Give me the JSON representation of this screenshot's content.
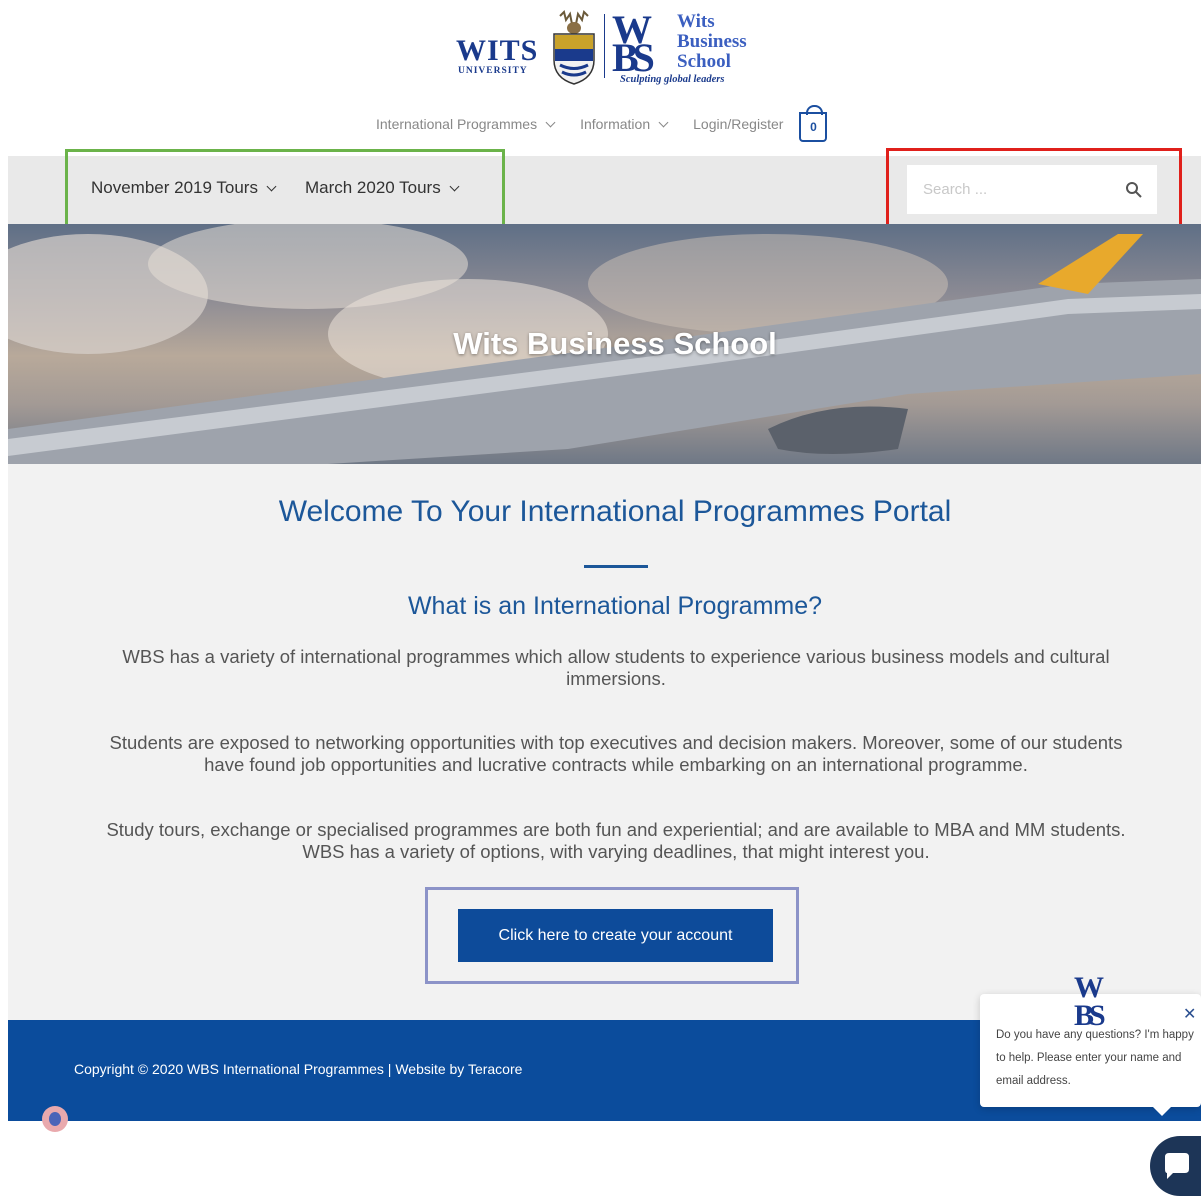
{
  "header": {
    "wits_logo_text": "WITS",
    "wits_logo_sub": "UNIVERSITY",
    "wbs_logo_mark_top": "W",
    "wbs_logo_mark_bottom": "BS",
    "wbs_logo_name": "Wits\nBusiness\nSchool",
    "wbs_logo_tagline": "Sculpting global leaders"
  },
  "top_nav": {
    "items": [
      {
        "label": "International Programmes"
      },
      {
        "label": "Information"
      },
      {
        "label": "Login/Register"
      }
    ],
    "cart_count": "0"
  },
  "secondary_nav": {
    "items": [
      {
        "label": "November 2019 Tours"
      },
      {
        "label": "March 2020 Tours"
      }
    ],
    "search_placeholder": "Search ..."
  },
  "hero": {
    "title": "Wits Business School"
  },
  "main": {
    "welcome": "Welcome To Your International Programmes Portal",
    "subhead": "What is an International Programme?",
    "paragraphs": [
      "WBS has a variety of international programmes which allow students to experience various business models and cultural immersions.",
      "Students are exposed to networking opportunities with top executives and decision makers. Moreover, some of our students have found job opportunities and lucrative contracts while embarking on an international programme.",
      "Study tours, exchange or specialised programmes are both fun and experiential; and are available to MBA and MM students. WBS has a variety of options, with varying deadlines, that might interest you."
    ],
    "cta_label": "Click here to create your account"
  },
  "footer": {
    "copyright": "Copyright © 2020 WBS International Programmes | Website by Teracore"
  },
  "chat": {
    "logo_top": "W",
    "logo_bottom": "BS",
    "message": "Do you have any questions? I'm happy to help. Please enter your name and email address.",
    "close_glyph": "✕"
  },
  "colors": {
    "brand_blue": "#0b4c9c",
    "heading_blue": "#1c5799",
    "highlight_green": "#6bb34a",
    "highlight_red": "#e0201b",
    "highlight_purple": "#8c93c8"
  }
}
